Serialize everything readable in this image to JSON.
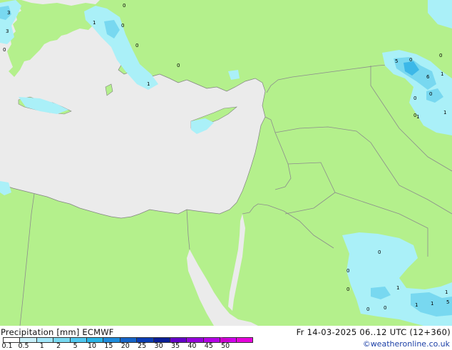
{
  "map": {
    "colors": {
      "sea": "#ebebeb",
      "land": "#b4f08c",
      "border": "#8c8c8c",
      "coast": "#828282",
      "precip_light": "#aaf0f8",
      "precip_mid": "#78d8f0",
      "precip_heavy": "#3cb8e8"
    },
    "labels": [
      "3",
      "3",
      "0",
      "1",
      "0",
      "0",
      "0",
      "0",
      "1",
      "5",
      "0",
      "6",
      "1",
      "0",
      "1",
      "0",
      "0",
      "0",
      "1",
      "0",
      "0",
      "0",
      "1",
      "0",
      "0",
      "1",
      "1",
      "5",
      "1"
    ]
  },
  "footer": {
    "title_left": "Precipitation [mm] ECMWF",
    "title_right": "Fr 14-03-2025 06..12 UTC (12+360)",
    "credit": "©weatheronline.co.uk",
    "legend_colors": [
      "#ffffff",
      "#c8f0fa",
      "#a0e6fa",
      "#78d8f0",
      "#50c8f0",
      "#28b4e6",
      "#1e8cdc",
      "#1464c8",
      "#0a3cb4",
      "#0a1e96",
      "#6400c8",
      "#9600dc",
      "#b400e6",
      "#d200f0",
      "#e600dc"
    ],
    "legend_ticks": [
      "0.1",
      "0.5",
      "1",
      "2",
      "5",
      "10",
      "15",
      "20",
      "25",
      "30",
      "35",
      "40",
      "45",
      "50"
    ]
  }
}
